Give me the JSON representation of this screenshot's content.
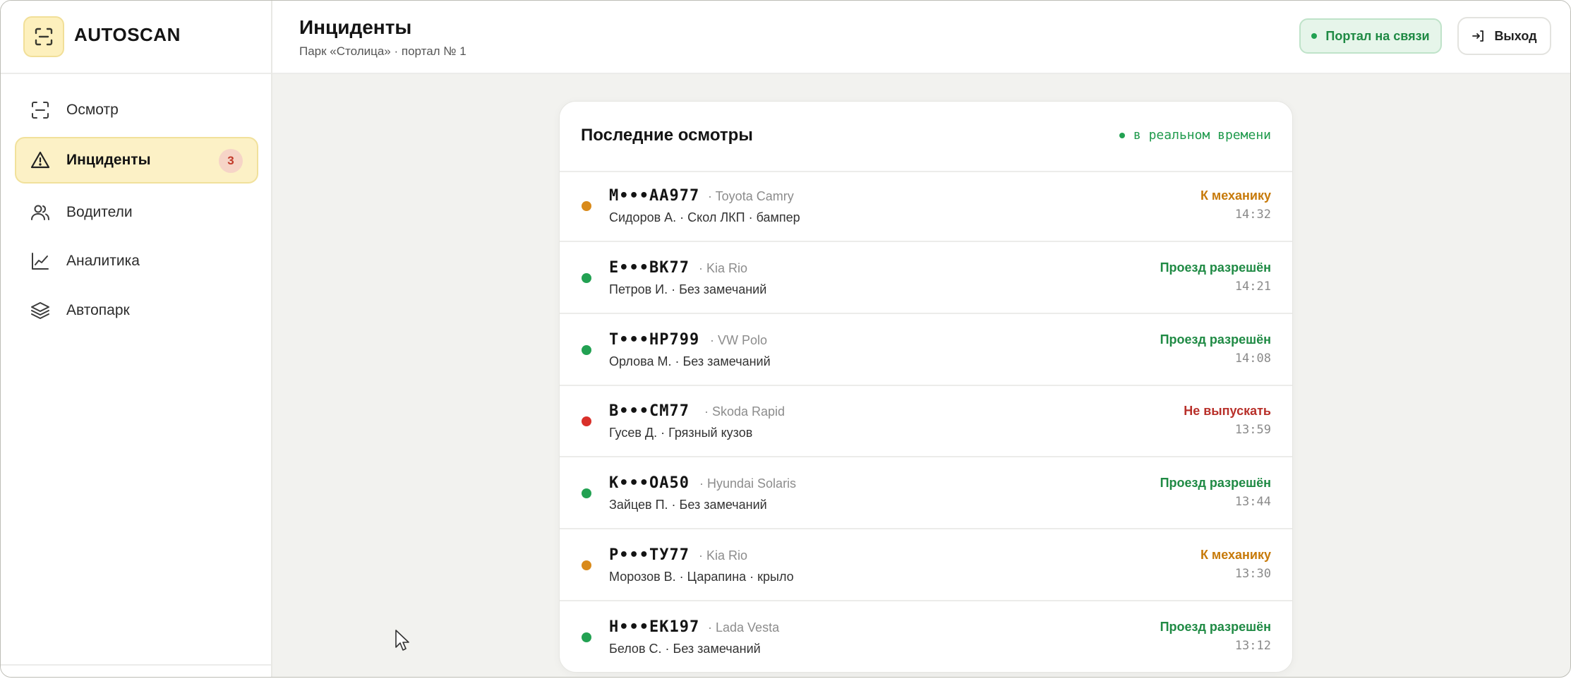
{
  "brand": {
    "name": "AUTOSCAN",
    "accent": "#f6d65a"
  },
  "sidebar": {
    "items": [
      {
        "label": "Осмотр",
        "icon": "scan-icon"
      },
      {
        "label": "Инциденты",
        "icon": "alert-triangle-icon",
        "badge": "3",
        "active": true
      },
      {
        "label": "Водители",
        "icon": "users-icon"
      },
      {
        "label": "Аналитика",
        "icon": "chart-line-icon"
      },
      {
        "label": "Автопарк",
        "icon": "layers-icon"
      }
    ]
  },
  "header": {
    "title": "Инциденты",
    "subtitle": "Парк «Столица» · портал № 1",
    "status_label": "Портал на связи",
    "logout_label": "Выход"
  },
  "card": {
    "title": "Последние осмотры",
    "live_label": "в реальном времени",
    "rows": [
      {
        "plate": "М•••АА977",
        "model": "· Toyota Camry",
        "meta": "Сидоров А. · Скол ЛКП · бампер",
        "status": "К механику",
        "time": "14:32",
        "status_color": "#c77a0a",
        "dot_color": "#d98a1a"
      },
      {
        "plate": "Е•••ВК77",
        "model": "· Kia Rio",
        "meta": "Петров И. · Без замечаний",
        "status": "Проезд разрешён",
        "time": "14:21",
        "status_color": "#1f8a44",
        "dot_color": "#22a152"
      },
      {
        "plate": "Т•••НР799",
        "model": "· VW Polo",
        "meta": "Орлова М. · Без замечаний",
        "status": "Проезд разрешён",
        "time": "14:08",
        "status_color": "#1f8a44",
        "dot_color": "#22a152"
      },
      {
        "plate": "В•••СМ77",
        "model": "· Skoda Rapid",
        "meta": "Гусев Д. · Грязный кузов",
        "status": "Не выпускать",
        "time": "13:59",
        "status_color": "#b8302a",
        "dot_color": "#d9302a"
      },
      {
        "plate": "К•••ОА50",
        "model": "· Hyundai Solaris",
        "meta": "Зайцев П. · Без замечаний",
        "status": "Проезд разрешён",
        "time": "13:44",
        "status_color": "#1f8a44",
        "dot_color": "#22a152"
      },
      {
        "plate": "Р•••ТУ77",
        "model": "· Kia Rio",
        "meta": "Морозов В. · Царапина · крыло",
        "status": "К механику",
        "time": "13:30",
        "status_color": "#c77a0a",
        "dot_color": "#d98a1a"
      },
      {
        "plate": "Н•••ЕК197",
        "model": "· Lada Vesta",
        "meta": "Белов С. · Без замечаний",
        "status": "Проезд разрешён",
        "time": "13:12",
        "status_color": "#1f8a44",
        "dot_color": "#22a152"
      }
    ]
  }
}
